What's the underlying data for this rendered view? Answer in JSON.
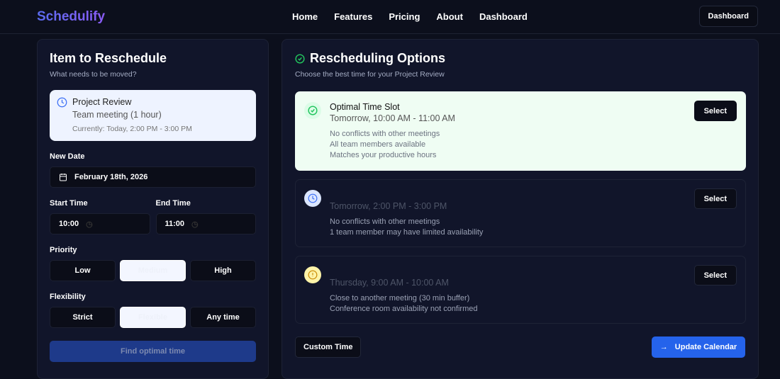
{
  "nav": {
    "logo": "Schedulify",
    "links": [
      "Home",
      "Features",
      "Pricing",
      "About",
      "Dashboard"
    ],
    "dashboard_button": "Dashboard"
  },
  "left": {
    "title": "Item to Reschedule",
    "subtitle": "What needs to be moved?",
    "item": {
      "name": "Project Review",
      "type": "Team meeting (1 hour)",
      "current": "Currently: Today, 2:00 PM - 3:00 PM"
    },
    "new_date_label": "New Date",
    "new_date": "February 18th, 2026",
    "start_label": "Start Time",
    "start": "10:00",
    "end_label": "End Time",
    "end": "11:00",
    "priority_label": "Priority",
    "priority": [
      "Low",
      "Medium",
      "High"
    ],
    "flex_label": "Flexibility",
    "flexibility": [
      "Strict",
      "Flexible",
      "Any time"
    ],
    "find": "Find optimal time"
  },
  "right": {
    "title": "Rescheduling Options",
    "subtitle": "Choose the best time for your Project Review",
    "options": [
      {
        "title": "Optimal Time Slot",
        "time": "Tomorrow, 10:00 AM - 11:00 AM",
        "notes": [
          "No conflicts with other meetings",
          "All team members available",
          "Matches your productive hours"
        ],
        "select": "Select"
      },
      {
        "title": "",
        "time": "Tomorrow, 2:00 PM - 3:00 PM",
        "notes": [
          "No conflicts with other meetings",
          "1 team member may have limited availability"
        ],
        "select": "Select"
      },
      {
        "title": "",
        "time": "Thursday, 9:00 AM - 10:00 AM",
        "notes": [
          "Close to another meeting (30 min buffer)",
          "Conference room availability not confirmed"
        ],
        "select": "Select"
      }
    ],
    "custom": "Custom Time",
    "update": "Update Calendar"
  }
}
